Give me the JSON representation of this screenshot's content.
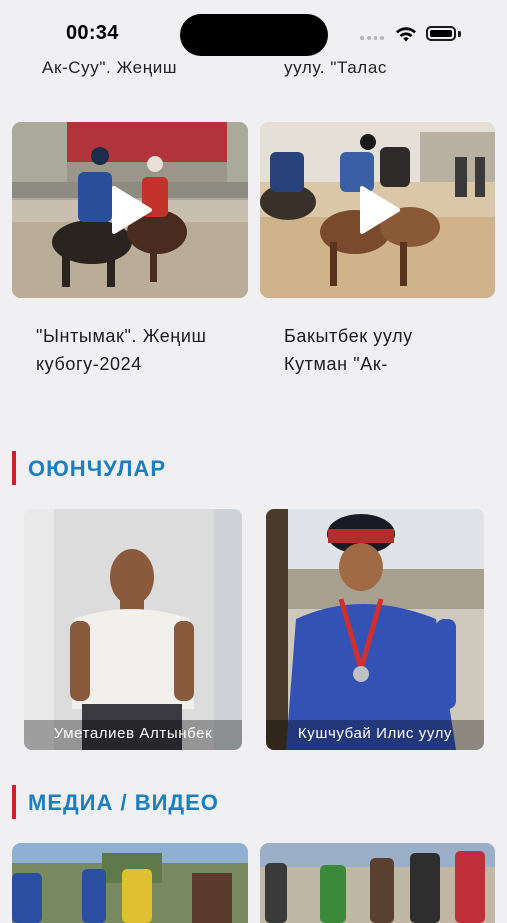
{
  "status_bar": {
    "time": "00:34"
  },
  "videos_top": {
    "cut_captions": [
      "Ак-Суу\". Жеңиш",
      "уулу. \"Талас"
    ],
    "items": [
      {
        "caption": "\"Ынтымак\". Жеңиш кубогу-2024"
      },
      {
        "caption": "Бакытбек уулу Кутман \"Ак-"
      }
    ]
  },
  "players_section": {
    "title": "ОЮНЧУЛАР",
    "players": [
      {
        "name": "Уметалиев Алтынбек"
      },
      {
        "name": "Кушчубай Илис уулу"
      }
    ]
  },
  "media_section": {
    "title": "МЕДИА / ВИДЕО"
  },
  "colors": {
    "accent_blue": "#1a7fc1",
    "accent_red": "#d01e2a",
    "background": "#f0f0f2"
  },
  "icons": [
    "wifi-icon",
    "battery-icon",
    "play-icon"
  ]
}
